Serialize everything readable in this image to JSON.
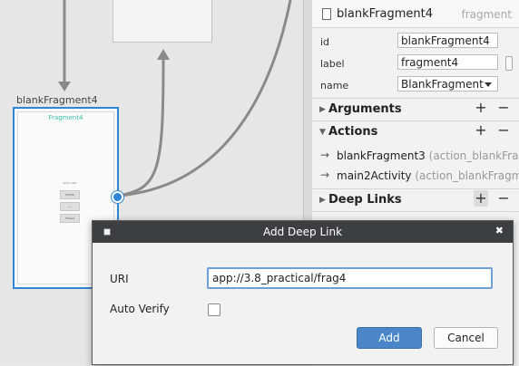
{
  "canvas": {
    "fragment_label": "blankFragment4",
    "fragment_card_title": "Fragment4",
    "mini_label": "enter text",
    "mini_buttons": [
      "HASTE",
      "----",
      "FRAG4"
    ]
  },
  "attributes": {
    "header_title": "blankFragment4",
    "header_type": "fragment",
    "fields": [
      {
        "label": "id",
        "value": "blankFragment4"
      },
      {
        "label": "label",
        "value": "fragment4"
      },
      {
        "label": "name",
        "value": "BlankFragment"
      }
    ],
    "sections": {
      "arguments": "Arguments",
      "actions": "Actions",
      "deep_links": "Deep Links"
    },
    "actions": [
      {
        "name": "blankFragment3",
        "detail": "(action_blankFrag"
      },
      {
        "name": "main2Activity",
        "detail": "(action_blankFragme"
      }
    ]
  },
  "dialog": {
    "title": "Add Deep Link",
    "uri_label": "URI",
    "uri_value": "app://3.8_practical/frag4",
    "auto_verify_label": "Auto Verify",
    "auto_verify_checked": false,
    "add_label": "Add",
    "cancel_label": "Cancel",
    "icons": {
      "close": "close-icon",
      "window": "window-icon"
    }
  },
  "colors": {
    "accent": "#2f86d4",
    "dialog_titlebar": "#3c3f41",
    "primary_button": "#4a86c8",
    "fragment_title": "#3bbfa8"
  }
}
